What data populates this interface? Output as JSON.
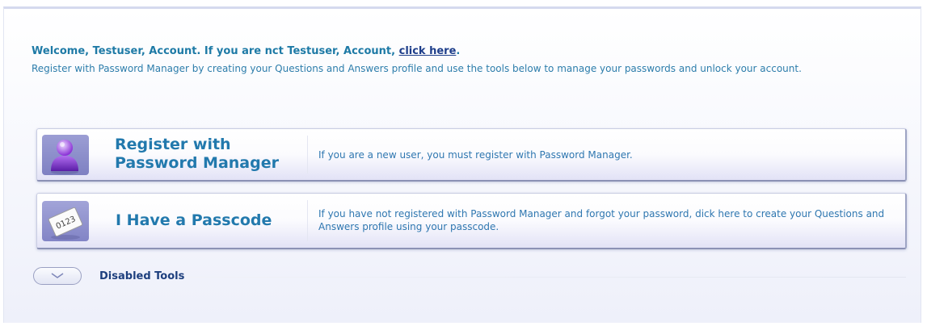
{
  "welcome": {
    "prefix": "Welcome, Testuser, Account. If you are nct Testuser, Account, ",
    "link": "click here",
    "suffix": "."
  },
  "intro": "Register with Password Manager by creating your Questions and Answers profile and use the tools below to manage your passwords and unlock your account.",
  "tools": [
    {
      "title": "Register with Password Manager",
      "description": "If you are a new user, you must register with Password Manager.",
      "icon": "user-icon"
    },
    {
      "title": "I Have a Passcode",
      "description": "If you have not registered with Password Manager and forgot your password, dick here to create your Questions and Answers profile using your passcode.",
      "icon": "passcode-card-icon"
    }
  ],
  "disabled_tools": {
    "label": "Disabled Tools",
    "icon": "chevron-down-icon"
  },
  "colors": {
    "heading_blue": "#1e7aa6",
    "link_navy": "#1e3e8a",
    "body_blue": "#2d7dab",
    "icon_purple": "#8c8ecb"
  }
}
